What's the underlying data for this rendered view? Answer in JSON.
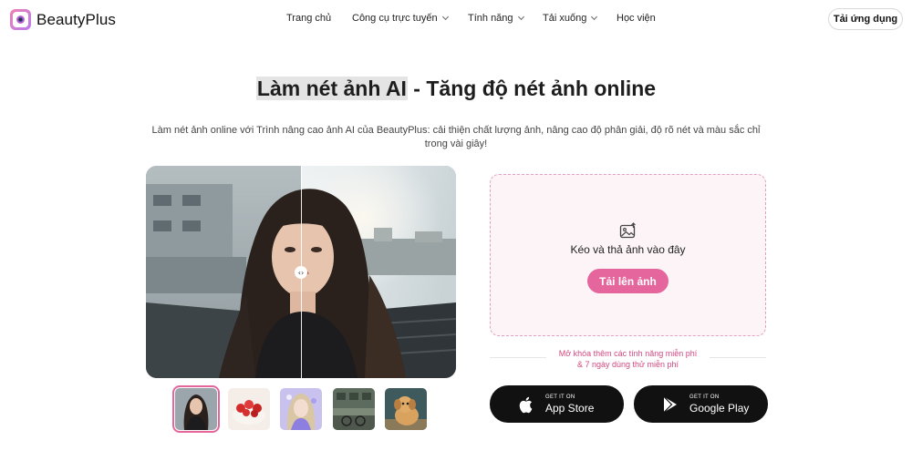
{
  "brand": {
    "name": "BeautyPlus"
  },
  "nav": {
    "items": [
      {
        "label": "Trang chủ",
        "has_dropdown": false
      },
      {
        "label": "Công cụ trực tuyến",
        "has_dropdown": true
      },
      {
        "label": "Tính năng",
        "has_dropdown": true
      },
      {
        "label": "Tải xuống",
        "has_dropdown": true
      },
      {
        "label": "Học viện",
        "has_dropdown": false
      }
    ],
    "get_app_label": "Tải ứng dụng"
  },
  "hero": {
    "title_highlight": "Làm nét ảnh AI",
    "title_rest": " - Tăng độ nét ảnh online",
    "subtitle": "Làm nét ảnh online với Trình nâng cao ảnh AI của BeautyPlus: cải thiện chất lượng ảnh, nâng cao độ phân giải, độ rõ nét và màu sắc chỉ trong vài giây!"
  },
  "compare": {
    "handle_icon": "left-right-arrows-icon",
    "handle_glyph": "‹›"
  },
  "thumbnails": [
    {
      "name": "portrait-woman",
      "active": true
    },
    {
      "name": "strawberry-cake",
      "active": false
    },
    {
      "name": "illustrated-girl",
      "active": false
    },
    {
      "name": "street-building",
      "active": false
    },
    {
      "name": "puppy",
      "active": false
    }
  ],
  "upload": {
    "icon": "image-upload-icon",
    "drop_text": "Kéo và thả ảnh vào đây",
    "button_label": "Tải lên ảnh"
  },
  "promo": {
    "line1": "Mở khóa thêm các tính năng miễn phí",
    "line2": "& 7 ngày dùng thử miễn phí"
  },
  "stores": {
    "app_store": {
      "small": "GET IT ON",
      "big": "App Store",
      "icon": "apple-icon"
    },
    "google_play": {
      "small": "GET IT ON",
      "big": "Google Play",
      "icon": "play-triangle-icon"
    }
  },
  "colors": {
    "accent": "#e5659d",
    "dark_button": "#111111",
    "upload_bg": "#fdf4f8",
    "promo_text": "#d1487f"
  }
}
